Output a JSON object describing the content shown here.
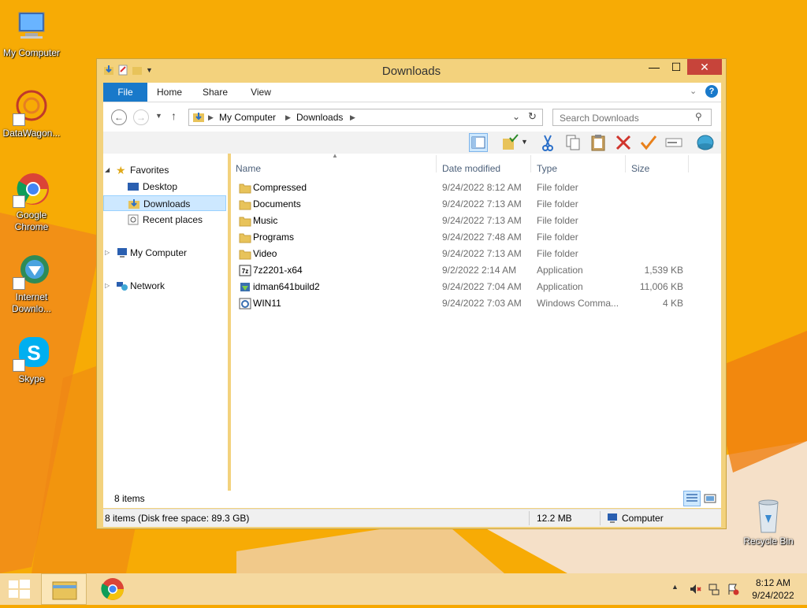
{
  "desktop": {
    "icons": [
      {
        "label": "My Computer"
      },
      {
        "label": "DataWagon..."
      },
      {
        "label": "Google Chrome"
      },
      {
        "label": "Internet Downlo..."
      },
      {
        "label": "Skype"
      },
      {
        "label": "Recycle Bin"
      }
    ]
  },
  "window": {
    "title": "Downloads",
    "controls": {
      "minimize": "—",
      "maximize": "☐",
      "close": "✕"
    }
  },
  "ribbon": {
    "tabs": [
      "File",
      "Home",
      "Share",
      "View"
    ]
  },
  "address": {
    "breadcrumbs": [
      "My Computer",
      "Downloads"
    ],
    "search_placeholder": "Search Downloads"
  },
  "nav_pane": {
    "favorites": "Favorites",
    "items": [
      "Desktop",
      "Downloads",
      "Recent places"
    ],
    "my_computer": "My Computer",
    "network": "Network"
  },
  "columns": [
    "Name",
    "Date modified",
    "Type",
    "Size"
  ],
  "files": [
    {
      "name": "Compressed",
      "date": "9/24/2022 8:12 AM",
      "type": "File folder",
      "size": "",
      "icon": "folder-icon"
    },
    {
      "name": "Documents",
      "date": "9/24/2022 7:13 AM",
      "type": "File folder",
      "size": "",
      "icon": "folder-icon"
    },
    {
      "name": "Music",
      "date": "9/24/2022 7:13 AM",
      "type": "File folder",
      "size": "",
      "icon": "folder-icon"
    },
    {
      "name": "Programs",
      "date": "9/24/2022 7:48 AM",
      "type": "File folder",
      "size": "",
      "icon": "folder-icon"
    },
    {
      "name": "Video",
      "date": "9/24/2022 7:13 AM",
      "type": "File folder",
      "size": "",
      "icon": "folder-icon"
    },
    {
      "name": "7z2201-x64",
      "date": "9/2/2022 2:14 AM",
      "type": "Application",
      "size": "1,539 KB",
      "icon": "7zip-icon"
    },
    {
      "name": "idman641build2",
      "date": "9/24/2022 7:04 AM",
      "type": "Application",
      "size": "11,006 KB",
      "icon": "installer-icon"
    },
    {
      "name": "WIN11",
      "date": "9/24/2022 7:03 AM",
      "type": "Windows Comma...",
      "size": "4 KB",
      "icon": "cmd-script-icon"
    }
  ],
  "items_count": "8 items",
  "status": {
    "left": "8 items (Disk free space: 89.3 GB)",
    "size": "12.2 MB",
    "location": "Computer"
  },
  "taskbar": {
    "time": "8:12 AM",
    "date": "9/24/2022"
  }
}
